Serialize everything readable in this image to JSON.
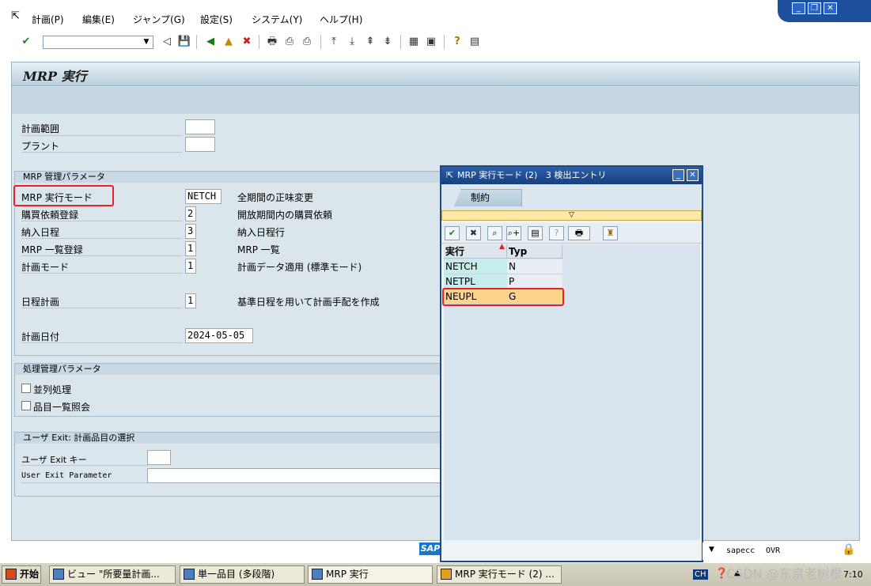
{
  "menu": {
    "items": [
      "計画(P)",
      "編集(E)",
      "ジャンプ(G)",
      "設定(S)",
      "システム(Y)",
      "ヘルプ(H)"
    ]
  },
  "window_buttons": {
    "minimize": "_",
    "restore": "❐",
    "close": "✕"
  },
  "toolbar": {
    "enter_glyph": "✔",
    "command_value": "",
    "dropdown_glyph": "▼",
    "glyphs": [
      "◁",
      "💾",
      "◀",
      "▲",
      "✖",
      "🖶",
      "⎙",
      "⎙",
      "⤒",
      "⤓",
      "⇞",
      "⇟",
      "▦",
      "▣",
      "?",
      "▤"
    ]
  },
  "screen": {
    "title": "MRP 実行"
  },
  "fields": {
    "plan_scope_label": "計画範囲",
    "plant_label": "プラント",
    "plan_scope_value": "",
    "plant_value": ""
  },
  "mrp_params": {
    "header": "MRP 管理パラメータ",
    "rows": [
      {
        "label": "MRP 実行モード",
        "value": "NETCH",
        "desc": "全期間の正味変更"
      },
      {
        "label": "購買依頼登録",
        "value": "2",
        "desc": "開放期間内の購買依頼"
      },
      {
        "label": "納入日程",
        "value": "3",
        "desc": "納入日程行"
      },
      {
        "label": "MRP 一覧登録",
        "value": "1",
        "desc": "MRP 一覧"
      },
      {
        "label": "計画モード",
        "value": "1",
        "desc": "計画データ適用 (標準モード)"
      },
      {
        "label": "日程計画",
        "value": "1",
        "desc": "基準日程を用いて計画手配を作成"
      },
      {
        "label": "計画日付",
        "value": "2024-05-05",
        "desc": ""
      }
    ]
  },
  "proc_params": {
    "header": "処理管理パラメータ",
    "parallel": "並列処理",
    "item_list": "品目一覧照会"
  },
  "user_exit": {
    "header": "ユーザ Exit: 計画品目の選択",
    "key_label": "ユーザ Exit キー",
    "param_label": "User Exit Parameter",
    "key_value": "",
    "param_value": ""
  },
  "popup": {
    "title": "MRP 実行モード (2)   3 検出エントリ",
    "tab": "制約",
    "yellow_glyph": "▽",
    "toolbar_glyphs": [
      "✔",
      "✖",
      "⌕",
      "⌕+",
      "▤",
      "?",
      "🖶",
      "♜"
    ],
    "columns": [
      "実行",
      "Typ"
    ],
    "rows": [
      {
        "run": "NETCH",
        "typ": "N"
      },
      {
        "run": "NETPL",
        "typ": "P"
      },
      {
        "run": "NEUPL",
        "typ": "G"
      }
    ]
  },
  "status": {
    "system": "sapecc",
    "mode": "OVR",
    "brand": "SAP"
  },
  "taskbar": {
    "start": "开始",
    "tasks": [
      "ビュー \"所要量計画...",
      "単一品目 (多段階)",
      "MRP 実行",
      "MRP 実行モード (2) ..."
    ],
    "lang": "CH",
    "time": "7:10",
    "watermark": "CSDN @东京老树根"
  },
  "colors": {
    "accent": "#1f4a85",
    "highlight": "#e8202a",
    "selected_row": "#fbd38a"
  }
}
